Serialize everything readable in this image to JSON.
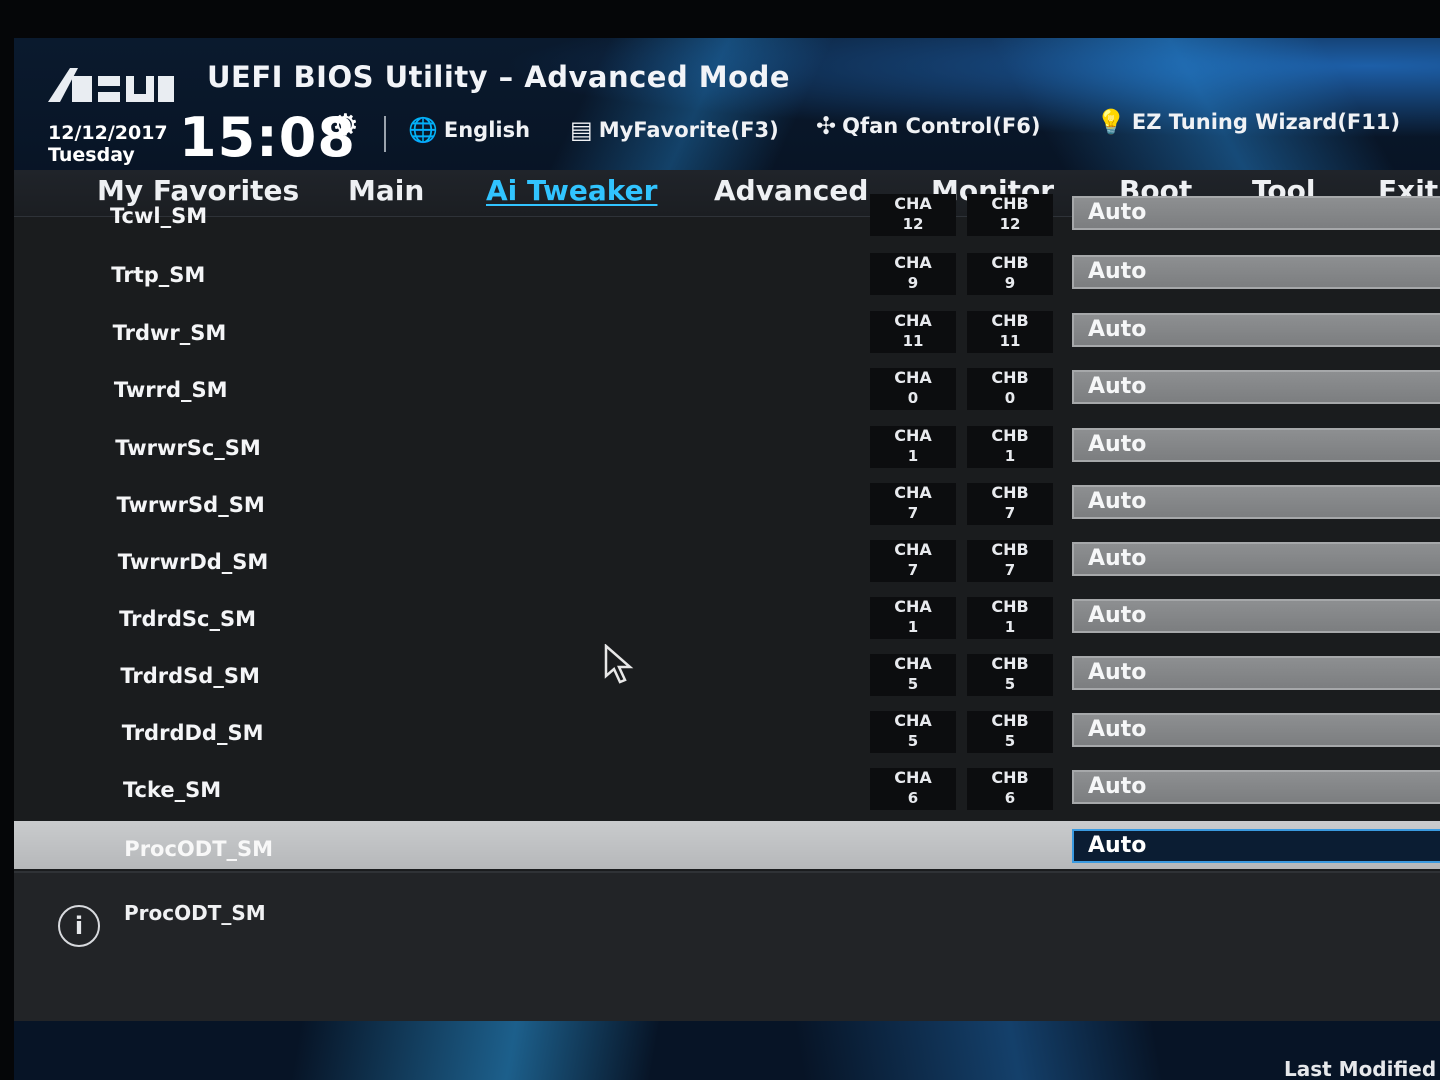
{
  "header": {
    "title": "UEFI BIOS Utility – Advanced Mode",
    "date": "12/12/2017",
    "day": "Tuesday",
    "time": "15:08",
    "tools": [
      {
        "label": "English",
        "icon": "globe-icon"
      },
      {
        "label": "MyFavorite(F3)",
        "icon": "favorite-icon"
      },
      {
        "label": "Qfan Control(F6)",
        "icon": "fan-icon"
      },
      {
        "label": "EZ Tuning Wizard(F11)",
        "icon": "bulb-icon"
      }
    ]
  },
  "nav": {
    "items": [
      "My Favorites",
      "Main",
      "Ai Tweaker",
      "Advanced",
      "Monitor",
      "Boot",
      "Tool",
      "Exit"
    ],
    "active": "Ai Tweaker"
  },
  "rows": [
    {
      "label": "Tcwl_SM",
      "cha": "12",
      "chb": "12",
      "value": "Auto"
    },
    {
      "label": "Trtp_SM",
      "cha": "9",
      "chb": "9",
      "value": "Auto"
    },
    {
      "label": "Trdwr_SM",
      "cha": "11",
      "chb": "11",
      "value": "Auto"
    },
    {
      "label": "Twrrd_SM",
      "cha": "0",
      "chb": "0",
      "value": "Auto"
    },
    {
      "label": "TwrwrSc_SM",
      "cha": "1",
      "chb": "1",
      "value": "Auto"
    },
    {
      "label": "TwrwrSd_SM",
      "cha": "7",
      "chb": "7",
      "value": "Auto"
    },
    {
      "label": "TwrwrDd_SM",
      "cha": "7",
      "chb": "7",
      "value": "Auto"
    },
    {
      "label": "TrdrdSc_SM",
      "cha": "1",
      "chb": "1",
      "value": "Auto"
    },
    {
      "label": "TrdrdSd_SM",
      "cha": "5",
      "chb": "5",
      "value": "Auto"
    },
    {
      "label": "TrdrdDd_SM",
      "cha": "5",
      "chb": "5",
      "value": "Auto"
    },
    {
      "label": "Tcke_SM",
      "cha": "6",
      "chb": "6",
      "value": "Auto"
    },
    {
      "label": "ProcODT_SM",
      "cha": "",
      "chb": "",
      "value": "Auto"
    }
  ],
  "channel_labels": {
    "a": "CHA",
    "b": "CHB"
  },
  "help": {
    "text": "ProcODT_SM"
  },
  "footer": {
    "text": "Last Modified"
  },
  "colors": {
    "accent": "#31c4ff",
    "highlight_row": "#c0c2c4",
    "select_bg": "#7f8183"
  }
}
